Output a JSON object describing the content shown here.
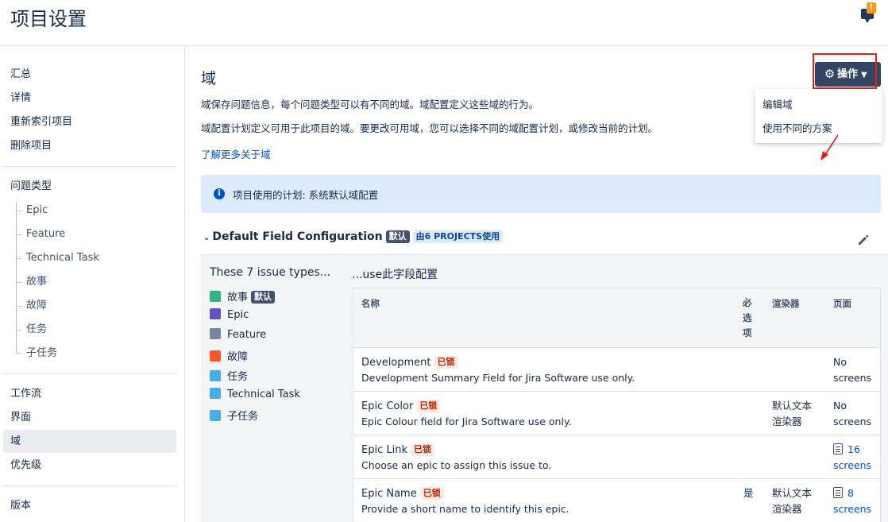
{
  "header": {
    "title": "项目设置",
    "feedback_badge": "!"
  },
  "sidebar": {
    "group1": [
      "汇总",
      "详情",
      "重新索引项目",
      "删除项目"
    ],
    "issue_types_label": "问题类型",
    "issue_types": [
      "Epic",
      "Feature",
      "Technical Task",
      "故事",
      "故障",
      "任务",
      "子任务"
    ],
    "group3": [
      "工作流",
      "界面",
      "域",
      "优先级"
    ],
    "group4": [
      "版本"
    ],
    "active": "域"
  },
  "main": {
    "title": "域",
    "desc1": "域保存问题信息，每个问题类型可以有不同的域。域配置定义这些域的行为。",
    "desc2": "域配置计划定义可用于此项目的域。要更改可用域，您可以选择不同的域配置计划，或修改当前的计划。",
    "learn_more": "了解更多关于域",
    "ops_button": "操作",
    "menu": [
      "编辑域",
      "使用不同的方案"
    ],
    "info": "项目使用的计划: 系统默认域配置",
    "config": {
      "name": "Default Field Configuration",
      "default_badge": "默认",
      "projects_prefix": "由",
      "projects_badge": "6 PROJECTS",
      "projects_suffix": "使用"
    },
    "types_title": "These 7 issue types...",
    "types": [
      {
        "name": "故事",
        "icon": "story-icon",
        "color": "#36b37e",
        "badge": "默认"
      },
      {
        "name": "Epic",
        "icon": "epic-icon",
        "color": "#6554c0"
      },
      {
        "name": "Feature",
        "icon": "feature-icon",
        "color": "#7a869a"
      },
      {
        "name": "故障",
        "icon": "bug-icon",
        "color": "#ff5630"
      },
      {
        "name": "任务",
        "icon": "task-icon",
        "color": "#4bade8"
      },
      {
        "name": "Technical Task",
        "icon": "subtask-icon",
        "color": "#4bade8"
      },
      {
        "name": "子任务",
        "icon": "subtask-icon",
        "color": "#4bade8"
      }
    ],
    "use_title": "...use此字段配置",
    "table": {
      "headers": {
        "name": "名称",
        "required": "必选项",
        "renderer": "渲染器",
        "screens": "页面"
      },
      "rows": [
        {
          "name": "Development",
          "locked": "已锁",
          "desc": "Development Summary Field for Jira Software use only.",
          "required": "",
          "renderer": "",
          "screens_line1": "No",
          "screens_line2": "screens",
          "screens_link": false
        },
        {
          "name": "Epic Color",
          "locked": "已锁",
          "desc": "Epic Colour field for Jira Software use only.",
          "required": "",
          "renderer_line1": "默认文本",
          "renderer_line2": "渲染器",
          "screens_line1": "No",
          "screens_line2": "screens",
          "screens_link": false
        },
        {
          "name": "Epic Link",
          "locked": "已锁",
          "desc": "Choose an epic to assign this issue to.",
          "required": "",
          "renderer": "",
          "screens_line1": "16",
          "screens_line2": "screens",
          "screens_link": true
        },
        {
          "name": "Epic Name",
          "locked": "已锁",
          "desc": "Provide a short name to identify this epic.",
          "required": "是",
          "renderer_line1": "默认文本",
          "renderer_line2": "渲染器",
          "screens_line1": "8",
          "screens_line2": "screens",
          "screens_link": true
        }
      ]
    }
  }
}
